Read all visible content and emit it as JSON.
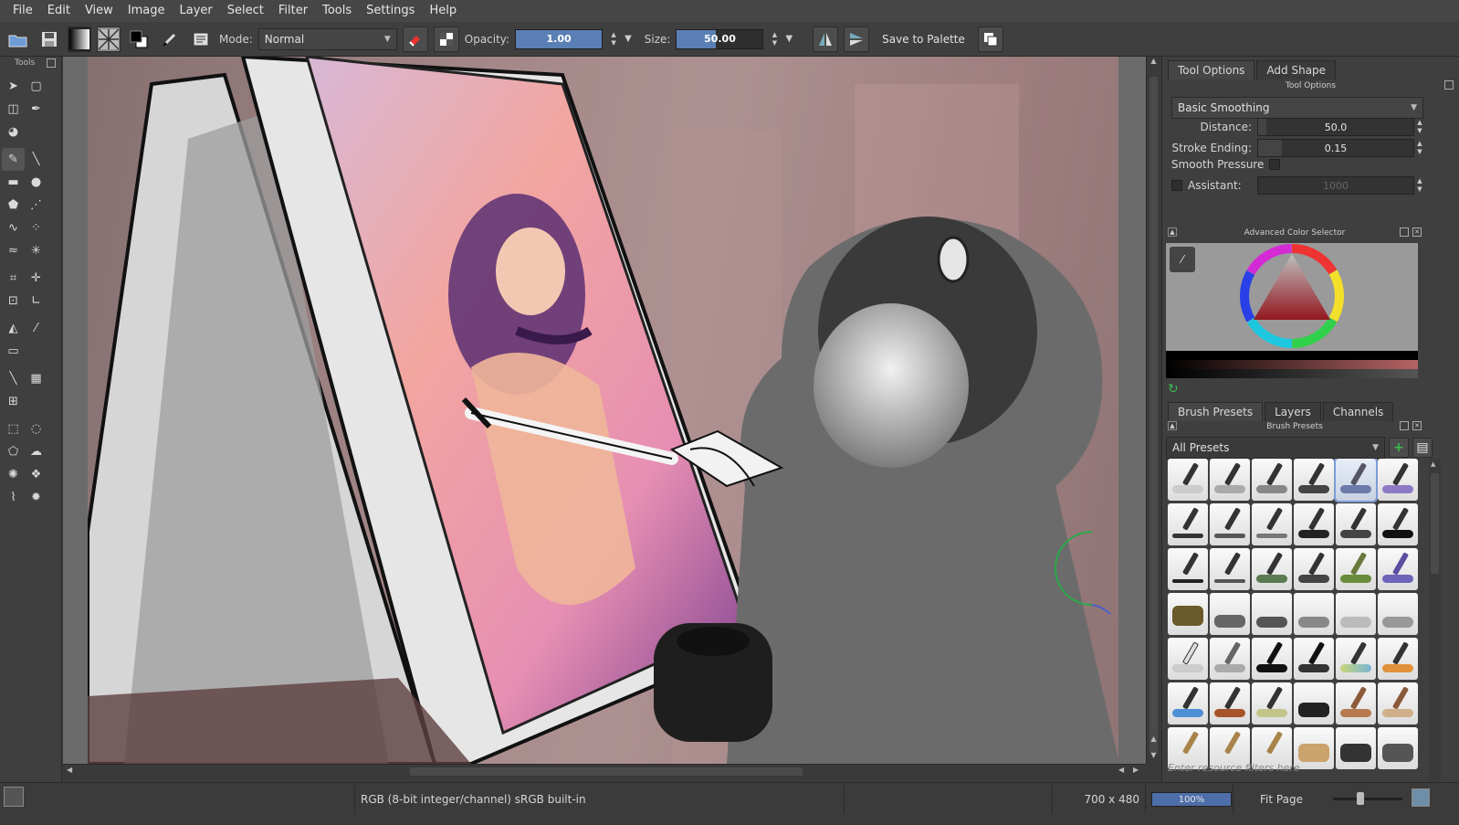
{
  "menu": [
    "File",
    "Edit",
    "View",
    "Image",
    "Layer",
    "Select",
    "Filter",
    "Tools",
    "Settings",
    "Help"
  ],
  "toolbar": {
    "mode_label": "Mode:",
    "mode_value": "Normal",
    "opacity_label": "Opacity:",
    "opacity_value": "1.00",
    "opacity_fraction": 1.0,
    "size_label": "Size:",
    "size_value": "50.00",
    "size_fraction": 0.45,
    "save_palette": "Save to Palette"
  },
  "toolbox": {
    "title": "Tools"
  },
  "docker": {
    "tabs": [
      "Tool Options",
      "Add Shape"
    ],
    "tool_options_title": "Tool Options",
    "smoothing": "Basic Smoothing",
    "distance_label": "Distance:",
    "distance_value": "50.0",
    "stroke_ending_label": "Stroke Ending:",
    "stroke_ending_value": "0.15",
    "smooth_pressure_label": "Smooth Pressure",
    "assistant_label": "Assistant:",
    "assistant_value": "1000",
    "color_selector_title": "Advanced Color Selector",
    "lower_tabs": [
      "Brush Presets",
      "Layers",
      "Channels"
    ],
    "brush_presets_title": "Brush Presets",
    "presets_filter": "All Presets",
    "resource_filter_placeholder": "Enter resource filters here"
  },
  "status": {
    "color_space": "RGB (8-bit integer/channel)  sRGB built-in",
    "dimensions": "700 x 480",
    "zoom": "100%",
    "zoom_fraction": 1.0,
    "fit": "Fit Page"
  },
  "colors": {
    "accent": "#5a7fb4",
    "panel": "#3f3f3f",
    "menubar": "#464646"
  }
}
